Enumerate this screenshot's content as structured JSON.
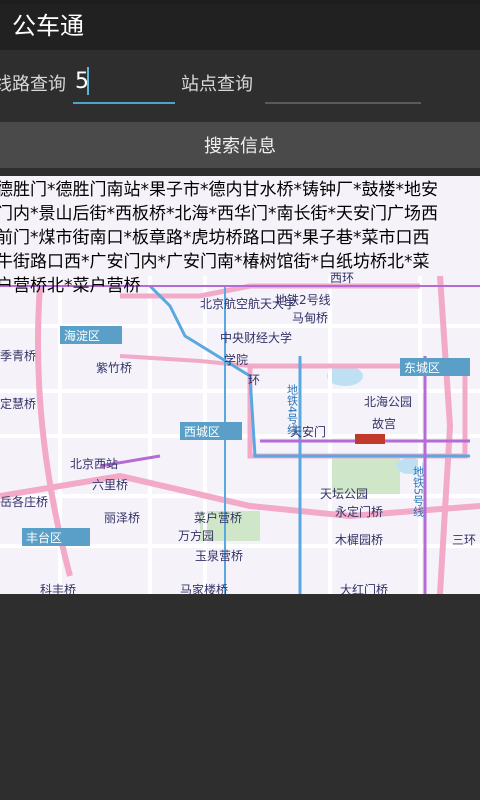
{
  "app": {
    "title": "公车通"
  },
  "search": {
    "route_label": "线路查询",
    "route_value": "5",
    "stop_label": "站点查询",
    "stop_value": ""
  },
  "search_button_label": "搜索信息",
  "result": {
    "lines": [
      "德胜门*德胜门南站*果子市*德内甘水桥*铸钟厂*鼓楼*地安",
      "门内*景山后街*西板桥*北海*西华门*南长街*天安门广场西",
      "前门*煤市街南口*板章路*虎坊桥路口西*果子巷*菜市口西",
      "牛街路口西*广安门内*广安门南*椿树馆街*白纸坊桥北*菜",
      "户营桥北*菜户营桥"
    ]
  },
  "map": {
    "labels": {
      "beihang": "北京航空航天大学",
      "xizhimen": "西环",
      "subway2": "地铁2号线",
      "madian": "马甸桥",
      "haidian": "海淀区",
      "cufe": "中央财经大学",
      "xueyuan": "学院",
      "zizhu": "紫竹桥",
      "ring2": "环",
      "dongcheng": "东城区",
      "beihai": "北海公园",
      "gugong": "故宫",
      "subway4": "地铁4号线",
      "tiananmen": "天安门",
      "xicheng": "西城区",
      "dingtai": "定慧桥",
      "jiqing": "季青桥",
      "bjwest": "北京西站",
      "liuli": "六里桥",
      "tiantan": "天坛公园",
      "yongding": "永定门桥",
      "subway5": "地铁5号线",
      "yuegezhuang": "岳各庄桥",
      "lize": "丽泽桥",
      "caihu": "菜户营桥",
      "wanfang": "万方园",
      "fengtai": "丰台区",
      "yuquan": "玉泉营桥",
      "muxiyuan": "木樨园桥",
      "ring3": "三环",
      "dahongmen": "大红门桥",
      "kehe": "科丰桥",
      "majia": "马家楼桥"
    },
    "colors": {
      "background": "#f5f2fa",
      "ring_road": "#f3a9c8",
      "subway_blue": "#5aa8e0",
      "subway_purple": "#b46bd6",
      "district_label_bg": "#5a9fc8",
      "park_green": "#cfe6c8"
    }
  }
}
